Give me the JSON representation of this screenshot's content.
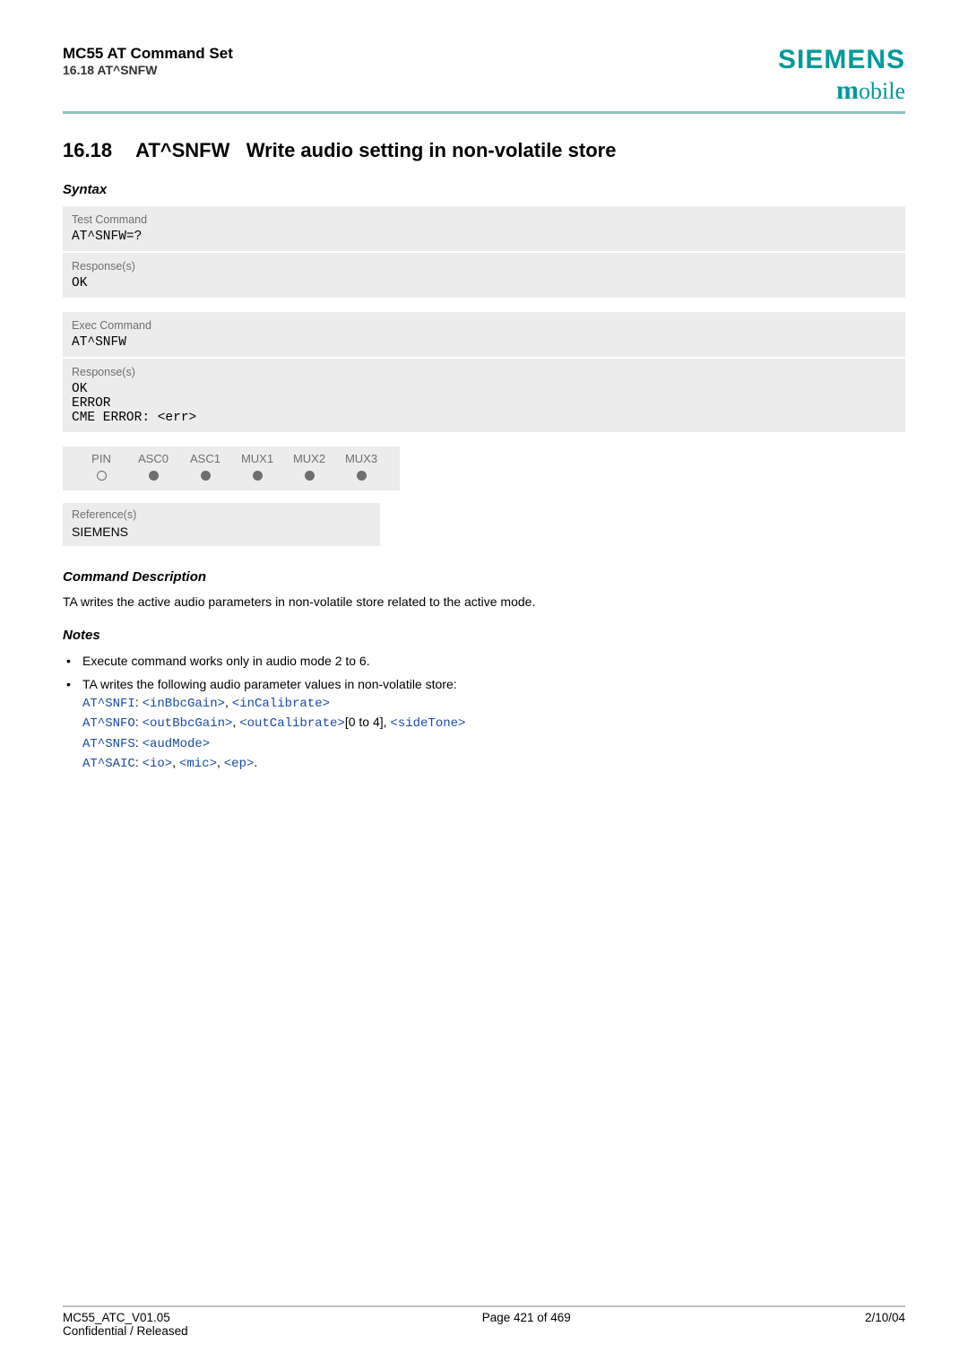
{
  "header": {
    "title": "MC55 AT Command Set",
    "sub": "16.18 AT^SNFW"
  },
  "logo": {
    "text": "SIEMENS",
    "sub": "obile",
    "subPrefix": "m"
  },
  "section": {
    "num": "16.18",
    "cmd": "AT^SNFW",
    "desc": "Write audio setting in non-volatile store"
  },
  "syntaxLabel": "Syntax",
  "testBox": {
    "label": "Test Command",
    "code": "AT^SNFW=?"
  },
  "testResp": {
    "label": "Response(s)",
    "code": "OK"
  },
  "execBox": {
    "label": "Exec Command",
    "code": "AT^SNFW"
  },
  "execResp": {
    "label": "Response(s)",
    "l1": "OK",
    "l2": "ERROR",
    "l3": "CME ERROR: <err>"
  },
  "chanHeaders": {
    "c0": "PIN",
    "c1": "ASC0",
    "c2": "ASC1",
    "c3": "MUX1",
    "c4": "MUX2",
    "c5": "MUX3"
  },
  "ref": {
    "label": "Reference(s)",
    "value": "SIEMENS"
  },
  "cmdDescHead": "Command Description",
  "cmdDescText": "TA writes the active audio parameters in non-volatile store related to the active mode.",
  "notesHead": "Notes",
  "note1": "Execute command works only in audio mode 2 to 6.",
  "note2": {
    "intro": "TA writes the following audio parameter values in non-volatile store:",
    "l1a": "AT^SNFI",
    "l1b": "<inBbcGain>",
    "l1c": "<inCalibrate>",
    "l2a": "AT^SNFO",
    "l2b": "<outBbcGain>",
    "l2c": "<outCalibrate>",
    "l2mid": "[0 to 4], ",
    "l2d": "<sideTone>",
    "l3a": "AT^SNFS",
    "l3b": "<audMode>",
    "l4a": "AT^SAIC",
    "l4b": "<io>",
    "l4c": "<mic>",
    "l4d": "<ep>"
  },
  "footer": {
    "left1": "MC55_ATC_V01.05",
    "left2": "Confidential / Released",
    "center": "Page 421 of 469",
    "right": "2/10/04"
  }
}
